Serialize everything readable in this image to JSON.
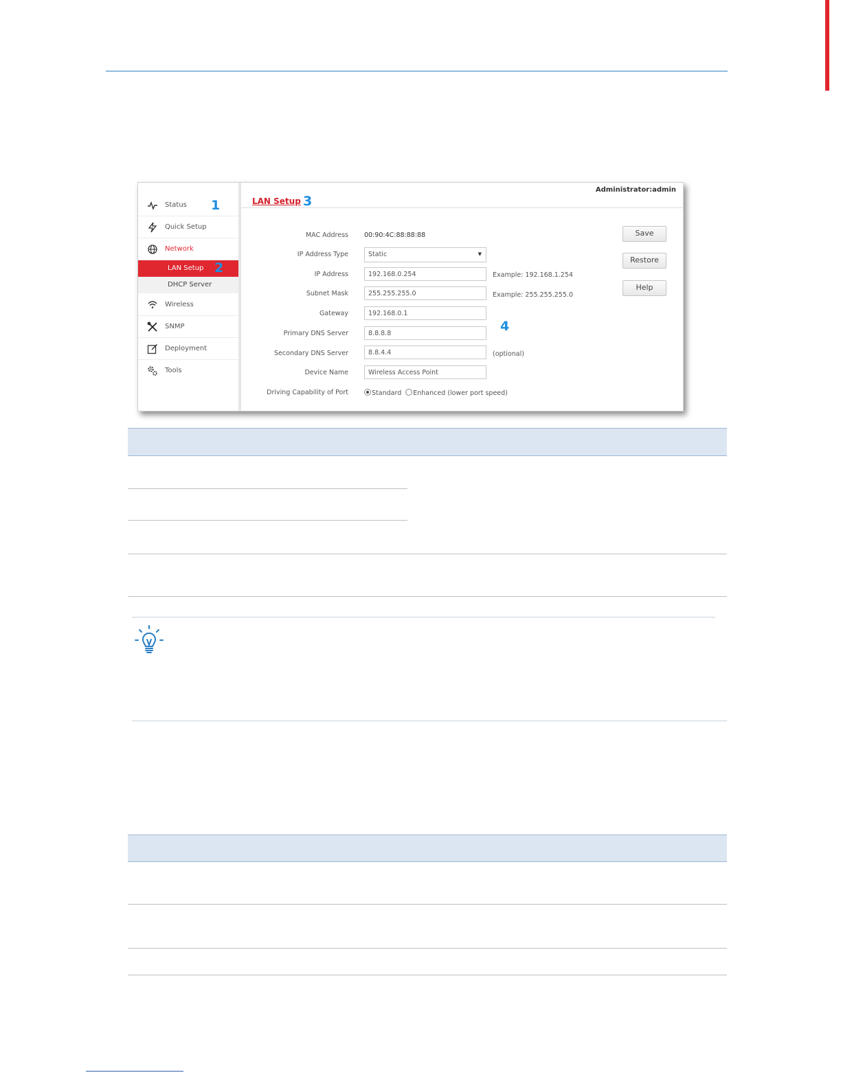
{
  "screenshot": {
    "admin_label": "Administrator:admin",
    "page_title": "LAN Setup",
    "callouts": [
      "1",
      "2",
      "3",
      "4"
    ],
    "sidebar": {
      "items": [
        {
          "label": "Status",
          "icon": "pulse-icon"
        },
        {
          "label": "Quick Setup",
          "icon": "lightning-icon"
        },
        {
          "label": "Network",
          "icon": "globe-icon",
          "active": true
        },
        {
          "label": "Wireless",
          "icon": "wifi-icon"
        },
        {
          "label": "SNMP",
          "icon": "tools-cross-icon"
        },
        {
          "label": "Deployment",
          "icon": "edit-icon"
        },
        {
          "label": "Tools",
          "icon": "gears-icon"
        }
      ],
      "subitems": [
        {
          "label": "LAN Setup",
          "active": true
        },
        {
          "label": "DHCP Server",
          "active": false
        }
      ]
    },
    "form": {
      "mac_label": "MAC Address",
      "mac_value": "00:90:4C:88:88:88",
      "ip_type_label": "IP Address Type",
      "ip_type_value": "Static",
      "ip_label": "IP Address",
      "ip_value": "192.168.0.254",
      "ip_hint": "Example: 192.168.1.254",
      "mask_label": "Subnet Mask",
      "mask_value": "255.255.255.0",
      "mask_hint": "Example: 255.255.255.0",
      "gateway_label": "Gateway",
      "gateway_value": "192.168.0.1",
      "dns1_label": "Primary DNS Server",
      "dns1_value": "8.8.8.8",
      "dns2_label": "Secondary DNS Server",
      "dns2_value": "8.8.4.4",
      "dns2_hint": "(optional)",
      "device_label": "Device Name",
      "device_value": "Wireless Access Point",
      "drive_label": "Driving Capability of Port",
      "drive_opt1": "Standard",
      "drive_opt2": "Enhanced (lower port speed)"
    },
    "buttons": {
      "save": "Save",
      "restore": "Restore",
      "help": "Help"
    }
  },
  "colors": {
    "accent_red": "#e0262f",
    "callout_blue": "#1f8fe0",
    "table_header": "#dce6f2",
    "rule_blue": "#2e7bc4"
  }
}
